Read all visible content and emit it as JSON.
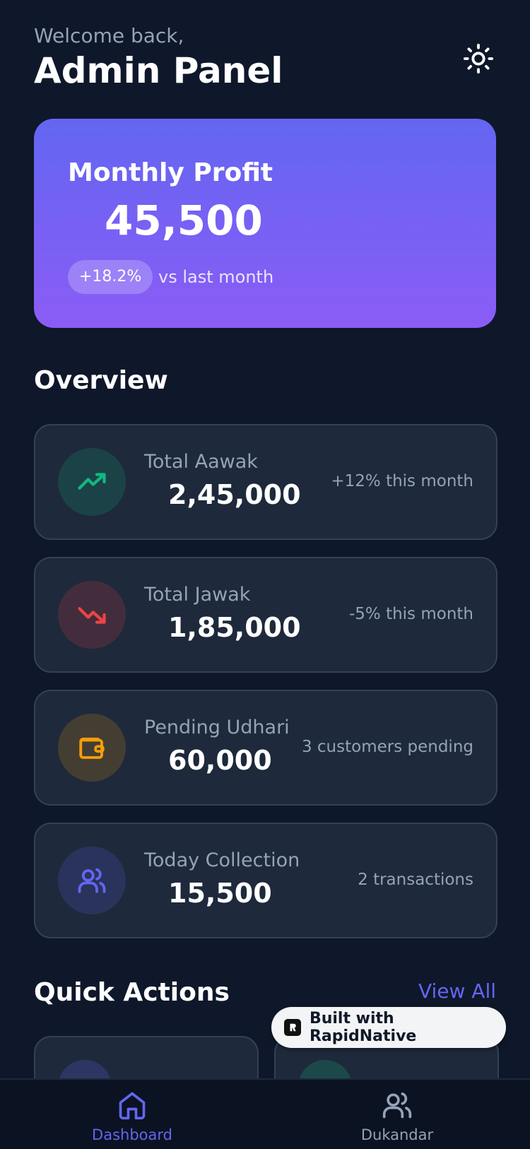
{
  "header": {
    "welcome": "Welcome back,",
    "title": "Admin Panel",
    "theme_icon": "sun-icon"
  },
  "profit": {
    "label": "Monthly Profit",
    "value": "45,500",
    "change": "+18.2%",
    "compare": "vs last month"
  },
  "overview": {
    "title": "Overview",
    "cards": [
      {
        "label": "Total Aawak",
        "value": "2,45,000",
        "note": "+12% this month",
        "icon": "trending-up-icon",
        "color": "#10b981"
      },
      {
        "label": "Total Jawak",
        "value": "1,85,000",
        "note": "-5% this month",
        "icon": "trending-down-icon",
        "color": "#ef4444"
      },
      {
        "label": "Pending Udhari",
        "value": "60,000",
        "note": "3 customers pending",
        "icon": "wallet-icon",
        "color": "#f59e0b"
      },
      {
        "label": "Today Collection",
        "value": "15,500",
        "note": "2 transactions",
        "icon": "users-icon",
        "color": "#6366f1"
      }
    ]
  },
  "quick_actions": {
    "title": "Quick Actions",
    "view_all": "View All"
  },
  "built_badge": {
    "text": "Built with RapidNative"
  },
  "tabbar": {
    "tabs": [
      {
        "label": "Dashboard",
        "icon": "home-icon",
        "active": true
      },
      {
        "label": "Dukandar",
        "icon": "users-icon",
        "active": false
      }
    ]
  },
  "colors": {
    "background": "#0f172a",
    "card": "#1e293b",
    "accent": "#6366f1",
    "accent_end": "#8b5cf6",
    "muted": "#94a3b8"
  }
}
